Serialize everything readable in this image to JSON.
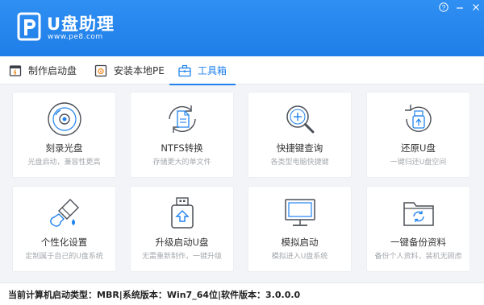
{
  "app": {
    "title": "U盘助理",
    "url": "www.pe8.com"
  },
  "window_controls": {
    "help": "?",
    "minimize": "—",
    "close": "✕"
  },
  "tabs": [
    {
      "label": "制作启动盘",
      "icon": "usb-drive-icon"
    },
    {
      "label": "安装本地PE",
      "icon": "gear-box-icon"
    },
    {
      "label": "工具箱",
      "icon": "toolbox-icon",
      "active": true
    }
  ],
  "tools": [
    {
      "title": "刻录光盘",
      "subtitle": "光盘启动，兼容性更高"
    },
    {
      "title": "NTFS转换",
      "subtitle": "存储更大的单文件"
    },
    {
      "title": "快捷键查询",
      "subtitle": "各类型电脑快捷键"
    },
    {
      "title": "还原U盘",
      "subtitle": "一键归还U盘空间"
    },
    {
      "title": "个性化设置",
      "subtitle": "定制属于自己的U盘系统"
    },
    {
      "title": "升级启动U盘",
      "subtitle": "无需重新制作，一键升级"
    },
    {
      "title": "模拟启动",
      "subtitle": "模拟进入U盘系统"
    },
    {
      "title": "一键备份资料",
      "subtitle": "备份个人资料，装机无顾虑"
    }
  ],
  "status": {
    "text": "当前计算机启动类型：MBR|系统版本：Win7_64位|软件版本：3.0.0.0"
  },
  "colors": {
    "accent": "#2082ee",
    "header": "#1f7ee8"
  }
}
